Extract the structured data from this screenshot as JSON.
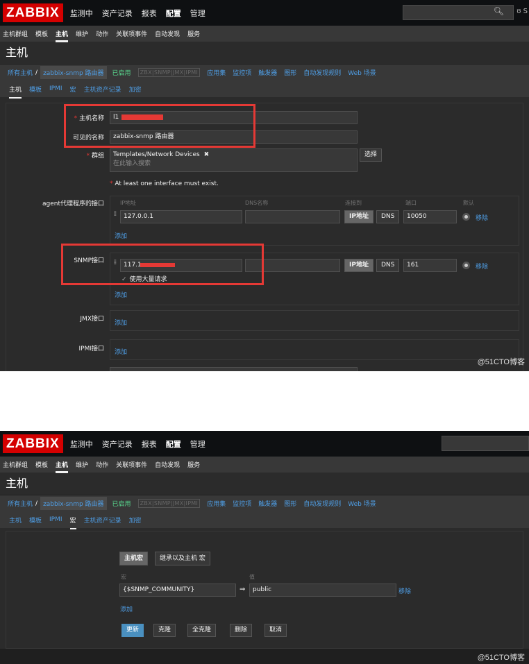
{
  "app": {
    "logo": "ZABBIX",
    "main_menu": [
      "监测中",
      "资产记录",
      "报表",
      "配置",
      "管理"
    ],
    "sub_menu": [
      "主机群组",
      "模板",
      "主机",
      "维护",
      "动作",
      "关联项事件",
      "自动发现",
      "服务"
    ],
    "page_title": "主机",
    "header_extra": "ʊ S",
    "search_icon": "search-icon"
  },
  "breadcrumb": {
    "all_hosts": "所有主机",
    "separator": "/",
    "host": "zabbix-snmp 路由器",
    "status": "已启用",
    "availability": "ZBX|SNMP|JMX|IPMI",
    "links": [
      "应用集",
      "监控项",
      "触发器",
      "图形",
      "自动发现规则",
      "Web 场景"
    ]
  },
  "tabs": [
    "主机",
    "模板",
    "IPMI",
    "宏",
    "主机资产记录",
    "加密"
  ],
  "host_form": {
    "host_name_label": "主机名称",
    "host_name_value": "l1",
    "visible_name_label": "可见的名称",
    "visible_name_value": "zabbix-snmp 路由器",
    "groups_label": "群组",
    "group_tag": "Templates/Network Devices",
    "group_remove": "✖",
    "group_placeholder": "在此输入搜索",
    "select_button": "选择",
    "warning": "At least one interface must exist.",
    "agent_label": "agent代理程序的接口",
    "col_ip": "IP地址",
    "col_dns": "DNS名称",
    "col_connect": "连接到",
    "col_port": "端口",
    "col_default": "默认",
    "agent_ip": "127.0.0.1",
    "agent_port": "10050",
    "btn_ip": "IP地址",
    "btn_dns": "DNS",
    "remove": "移除",
    "add": "添加",
    "snmp_label": "SNMP接口",
    "snmp_ip": "117.1",
    "snmp_port": "161",
    "bulk_label": "使用大量请求",
    "bulk_check": "✓",
    "jmx_label": "JMX接口",
    "ipmi_label": "IPMI接口"
  },
  "macro_form": {
    "tab_host": "主机宏",
    "tab_inherited": "继承以及主机 宏",
    "col_macro": "宏",
    "col_value": "值",
    "macro": "{$SNMP_COMMUNITY}",
    "arrow": "⇒",
    "value": "public",
    "remove": "移除",
    "add": "添加",
    "buttons": [
      "更新",
      "克隆",
      "全克隆",
      "删除",
      "取消"
    ]
  },
  "watermark": "@51CTO博客",
  "colors": {
    "accent_red": "#d40000",
    "link_blue": "#4f9fe7",
    "enabled_green": "#59db8f",
    "annotation_red": "#e53935"
  }
}
